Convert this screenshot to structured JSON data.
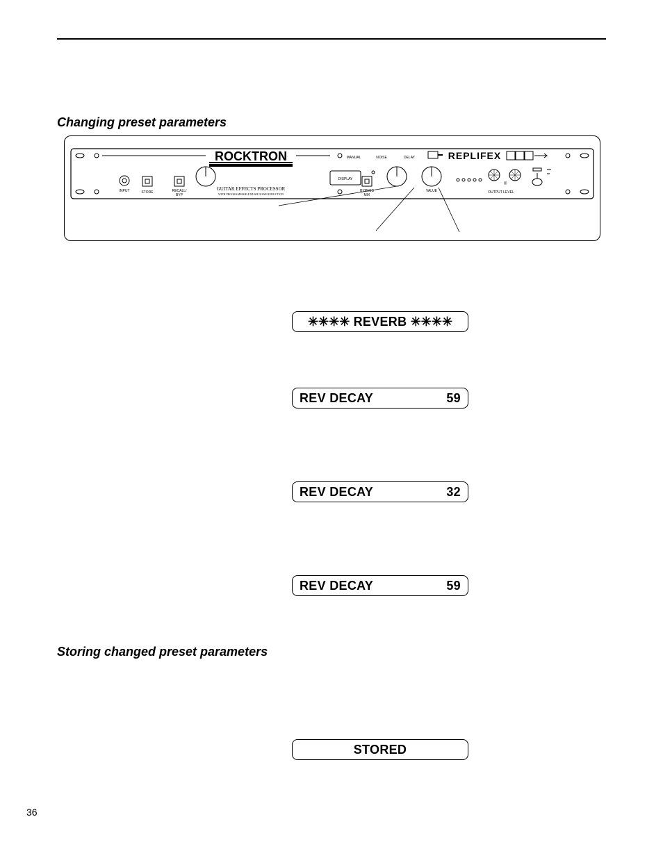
{
  "page_number": "36",
  "headings": {
    "changing": "Changing preset parameters",
    "storing": "Storing changed preset parameters"
  },
  "device": {
    "brand": "ROCKTRON",
    "subtitle": "GUITAR EFFECTS PROCESSOR",
    "model": "REPLIFEX"
  },
  "displays": {
    "reverb_title": {
      "stars_left": "✳✳✳✳",
      "label": " REVERB ",
      "stars_right": "✳✳✳✳"
    },
    "rev_decay_a": {
      "param": "REV DECAY",
      "value": "59"
    },
    "rev_decay_b": {
      "param": "REV DECAY",
      "value": "32"
    },
    "rev_decay_c": {
      "param": "REV DECAY",
      "value": "59"
    },
    "stored": {
      "label": "STORED"
    }
  }
}
